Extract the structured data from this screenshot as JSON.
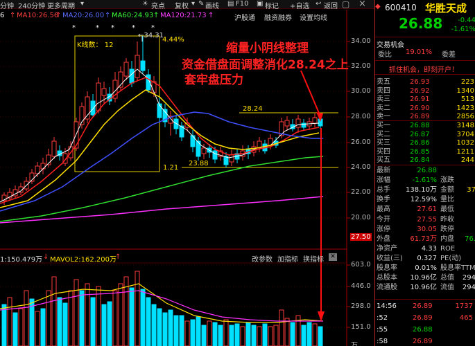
{
  "toolbar": {
    "items": [
      "分钟",
      "240分钟",
      "更多周期",
      "亮点",
      "复权",
      "画线",
      "F10",
      "标记",
      "+自选",
      "返回"
    ]
  },
  "legend": {
    "ma5_partial": "6",
    "ma10": "MA10:26.56",
    "ma20": "MA20:26.00",
    "ma60": "MA60:24.93",
    "ma120": "MA120:21.73",
    "arrow": "↑"
  },
  "tabs": {
    "items": [
      "沪股通",
      "融资融券",
      "设置均线"
    ]
  },
  "window_controls": {
    "close": "×",
    "restore": "▢"
  },
  "right_axis": {
    "price_ticks": [
      "34.00",
      "32.00",
      "30.00",
      "28.00",
      "26.00",
      "24.00",
      "22.00",
      "20.00"
    ],
    "vol_ticks": [
      "603.0",
      "446.0",
      "298.0",
      "151.0",
      "万"
    ]
  },
  "chart_labels": {
    "kline_count": "K线数： 12",
    "high_label": "←34.31",
    "pct": "4.44%",
    "stars": [
      "*",
      "*",
      "*",
      "*",
      "*"
    ],
    "level_2824": "28.24",
    "level_2388": "23.88",
    "level_121": "1.21",
    "price_2750": "27.50"
  },
  "annotation": {
    "line1": "缩量小阴线整理",
    "line2": "资金借盘面调整消化28.24之上",
    "line3": "套牢盘压力"
  },
  "volume_panel": {
    "label": "1:150.479万",
    "mavol2": "MAVOL2:162.200万",
    "arrow_down": "↓",
    "arrow_up": "↑",
    "buttons": [
      "改参数",
      "加指标",
      "换指标"
    ]
  },
  "stock": {
    "code": "600410",
    "name": "华胜天成",
    "price": "26.88",
    "change": "-0.44",
    "change_pct": "-1.61%",
    "tab_trade": "交易机会",
    "weibi_label": "委比",
    "weibi_value": "19.01%",
    "weicha_label": "委差",
    "promo": "抓住机会，即刻开户！"
  },
  "order_book": {
    "sell": [
      {
        "label": "卖五",
        "price": "26.93",
        "vol": "223"
      },
      {
        "label": "卖四",
        "price": "26.92",
        "vol": "1340"
      },
      {
        "label": "卖三",
        "price": "26.91",
        "vol": "513"
      },
      {
        "label": "卖二",
        "price": "26.90",
        "vol": "1423"
      },
      {
        "label": "卖一",
        "price": "26.89",
        "vol": "2856"
      }
    ],
    "buy": [
      {
        "label": "买一",
        "price": "26.88",
        "vol": "3148"
      },
      {
        "label": "买二",
        "price": "26.87",
        "vol": "3704"
      },
      {
        "label": "买三",
        "price": "26.86",
        "vol": "1032"
      },
      {
        "label": "买四",
        "price": "26.85",
        "vol": "1211"
      },
      {
        "label": "买五",
        "price": "26.84",
        "vol": "244"
      }
    ]
  },
  "stats": [
    {
      "l1": "最新",
      "v1": "26.88",
      "c1": "green",
      "l2": "",
      "v2": "",
      "c2": "white"
    },
    {
      "l1": "涨幅",
      "v1": "-1.61%",
      "c1": "green",
      "l2": "涨跌",
      "v2": "",
      "c2": "white"
    },
    {
      "l1": "总手",
      "v1": "138.10万",
      "c1": "white",
      "l2": "金额",
      "v2": "37",
      "c2": "yellow"
    },
    {
      "l1": "换手",
      "v1": "12.59%",
      "c1": "white",
      "l2": "量比",
      "v2": "",
      "c2": "white"
    },
    {
      "l1": "最高",
      "v1": "27.61",
      "c1": "red",
      "l2": "最低",
      "v2": "",
      "c2": "white"
    },
    {
      "l1": "今开",
      "v1": "27.55",
      "c1": "red",
      "l2": "昨收",
      "v2": "",
      "c2": "white"
    },
    {
      "l1": "涨停",
      "v1": "30.05",
      "c1": "red",
      "l2": "跌停",
      "v2": "",
      "c2": "white"
    },
    {
      "l1": "外盘",
      "v1": "61.73万",
      "c1": "red",
      "l2": "内盘",
      "v2": "76.",
      "c2": "green"
    },
    {
      "l1": "净资产",
      "v1": "4.33",
      "c1": "white",
      "l2": "ROE",
      "v2": "",
      "c2": "white"
    },
    {
      "l1": "收益(三)",
      "v1": "0.327",
      "c1": "white",
      "l2": "PE(动)",
      "v2": "",
      "c2": "white"
    },
    {
      "l1": "股息率",
      "v1": "0.01%",
      "c1": "white",
      "l2": "股息率TTM",
      "v2": "",
      "c2": "white"
    },
    {
      "l1": "总股本",
      "v1": "10.96亿",
      "c1": "white",
      "l2": "总值",
      "v2": "294",
      "c2": "white"
    },
    {
      "l1": "流通股",
      "v1": "10.96亿",
      "c1": "white",
      "l2": "流值",
      "v2": "294",
      "c2": "white"
    }
  ],
  "ticks": [
    {
      "time": "14:56",
      "price": "26.89",
      "vol": "1737",
      "pc": "red",
      "vc": "red"
    },
    {
      "time": ":52",
      "price": "26.89",
      "vol": "465",
      "pc": "red",
      "vc": "red"
    },
    {
      "time": ":55",
      "price": "26.88",
      "vol": "",
      "pc": "green",
      "vc": "white"
    },
    {
      "time": ":58",
      "price": "26.89",
      "vol": "",
      "pc": "red",
      "vc": "white"
    }
  ]
}
